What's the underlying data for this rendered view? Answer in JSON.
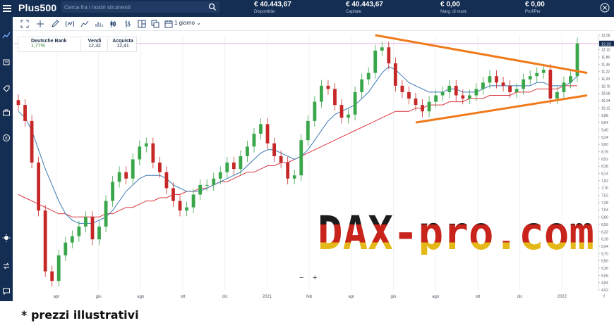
{
  "header": {
    "logo": "Plus500",
    "search_placeholder": "Cerca fra i nostri strumenti",
    "stats": [
      {
        "value": "€ 40.443,67",
        "label": "Disponibile"
      },
      {
        "value": "€ 40.443,67",
        "label": "Capitale"
      },
      {
        "value": "€ 0,00",
        "label": "Marg. di mant."
      },
      {
        "value": "€ 0,00",
        "label": "Prof/Per"
      }
    ]
  },
  "toolbar": {
    "period": "1 giorno"
  },
  "instrument": {
    "name": "Deutsche Bank",
    "change": "1,77%",
    "sell_label": "Vendi",
    "sell": "12,32",
    "buy_label": "Acquista",
    "buy": "12,41"
  },
  "zoom": {
    "minus": "−",
    "plus": "+"
  },
  "watermark": "DAX-pro.com",
  "footnote": "* prezzi illustrativi",
  "chart_data": {
    "type": "candlestick",
    "y_ticks": [
      "12,58",
      "12,34",
      "12,10",
      "11,86",
      "11,46",
      "11,22",
      "11,00",
      "10,76",
      "10,58",
      "10,34",
      "10,12",
      "9,88",
      "9,64",
      "9,40",
      "9,24",
      "9,00",
      "8,76",
      "8,52",
      "8,38",
      "8,14",
      "7,92",
      "7,76",
      "7,52",
      "7,28",
      "7,04",
      "6,80",
      "6,56",
      "6,32",
      "6,18",
      "5,94",
      "5,70",
      "5,50",
      "5,26",
      "5,08",
      "4,84",
      "4,62"
    ],
    "x_ticks": [
      "apr",
      "giu",
      "ago",
      "ott",
      "dic",
      "2021",
      "feb",
      "apr",
      "giu",
      "ago",
      "ott",
      "dic",
      "2022",
      "f"
    ],
    "current_price_label": "12,32",
    "ylim": [
      4.62,
      12.58
    ],
    "series": [
      {
        "name": "price",
        "close": [
          10.4,
          9.9,
          8.6,
          7.1,
          5.2,
          4.9,
          5.7,
          6.1,
          6.3,
          6.6,
          6.9,
          6.2,
          6.6,
          7.4,
          8.0,
          8.3,
          8.1,
          8.7,
          9.1,
          9.2,
          8.6,
          8.3,
          7.8,
          7.4,
          7.1,
          7.2,
          7.6,
          7.9,
          7.9,
          8.1,
          8.3,
          8.6,
          8.4,
          8.8,
          9.1,
          9.5,
          9.8,
          9.2,
          8.8,
          8.6,
          8.1,
          8.2,
          9.3,
          9.9,
          10.5,
          11.0,
          10.9,
          10.4,
          10.0,
          10.1,
          10.8,
          11.2,
          11.4,
          12.1,
          12.2,
          11.7,
          11.0,
          10.8,
          10.6,
          10.4,
          10.2,
          10.5,
          10.7,
          10.8,
          11.0,
          10.7,
          10.6,
          10.7,
          10.9,
          11.1,
          11.3,
          11.1,
          11.0,
          10.8,
          10.9,
          11.2,
          11.3,
          11.4,
          11.5,
          10.6,
          10.8,
          11.1,
          11.3,
          12.32
        ]
      },
      {
        "name": "ma_short",
        "values": [
          10.2,
          10.0,
          9.6,
          9.0,
          8.4,
          7.9,
          7.4,
          7.0,
          6.8,
          6.7,
          6.7,
          6.7,
          6.8,
          6.9,
          7.1,
          7.4,
          7.7,
          7.9,
          8.1,
          8.2,
          8.2,
          8.2,
          8.1,
          7.9,
          7.8,
          7.7,
          7.7,
          7.7,
          7.8,
          7.9,
          8.0,
          8.1,
          8.2,
          8.3,
          8.5,
          8.7,
          8.9,
          9.0,
          9.0,
          8.9,
          8.8,
          8.7,
          8.8,
          9.0,
          9.3,
          9.6,
          9.9,
          10.1,
          10.2,
          10.3,
          10.4,
          10.6,
          10.8,
          11.1,
          11.4,
          11.6,
          11.5,
          11.3,
          11.1,
          11.0,
          10.9,
          10.8,
          10.8,
          10.8,
          10.9,
          10.9,
          10.8,
          10.8,
          10.8,
          10.9,
          11.0,
          11.0,
          11.0,
          11.0,
          11.0,
          11.0,
          11.0,
          11.1,
          11.1,
          11.0,
          11.0,
          11.0,
          11.1,
          11.3
        ]
      },
      {
        "name": "ma_long",
        "values": [
          7.6,
          7.5,
          7.4,
          7.3,
          7.2,
          7.1,
          7.0,
          7.0,
          6.9,
          6.9,
          6.9,
          6.9,
          6.9,
          7.0,
          7.0,
          7.1,
          7.2,
          7.2,
          7.3,
          7.4,
          7.4,
          7.5,
          7.5,
          7.6,
          7.6,
          7.7,
          7.7,
          7.8,
          7.8,
          7.9,
          8.0,
          8.0,
          8.1,
          8.2,
          8.3,
          8.3,
          8.4,
          8.5,
          8.5,
          8.6,
          8.6,
          8.7,
          8.8,
          8.9,
          9.0,
          9.1,
          9.2,
          9.3,
          9.4,
          9.5,
          9.6,
          9.7,
          9.8,
          9.9,
          10.0,
          10.1,
          10.2,
          10.2,
          10.2,
          10.3,
          10.3,
          10.4,
          10.4,
          10.4,
          10.5,
          10.5,
          10.5,
          10.6,
          10.6,
          10.6,
          10.7,
          10.7,
          10.7,
          10.7,
          10.8,
          10.8,
          10.8,
          10.9,
          10.9,
          10.9,
          10.9,
          11.0,
          11.0,
          11.0
        ]
      }
    ],
    "trendlines": [
      {
        "from": [
          53,
          12.58
        ],
        "to": [
          83,
          11.4
        ]
      },
      {
        "from": [
          59,
          9.85
        ],
        "to": [
          83,
          10.7
        ]
      }
    ]
  }
}
